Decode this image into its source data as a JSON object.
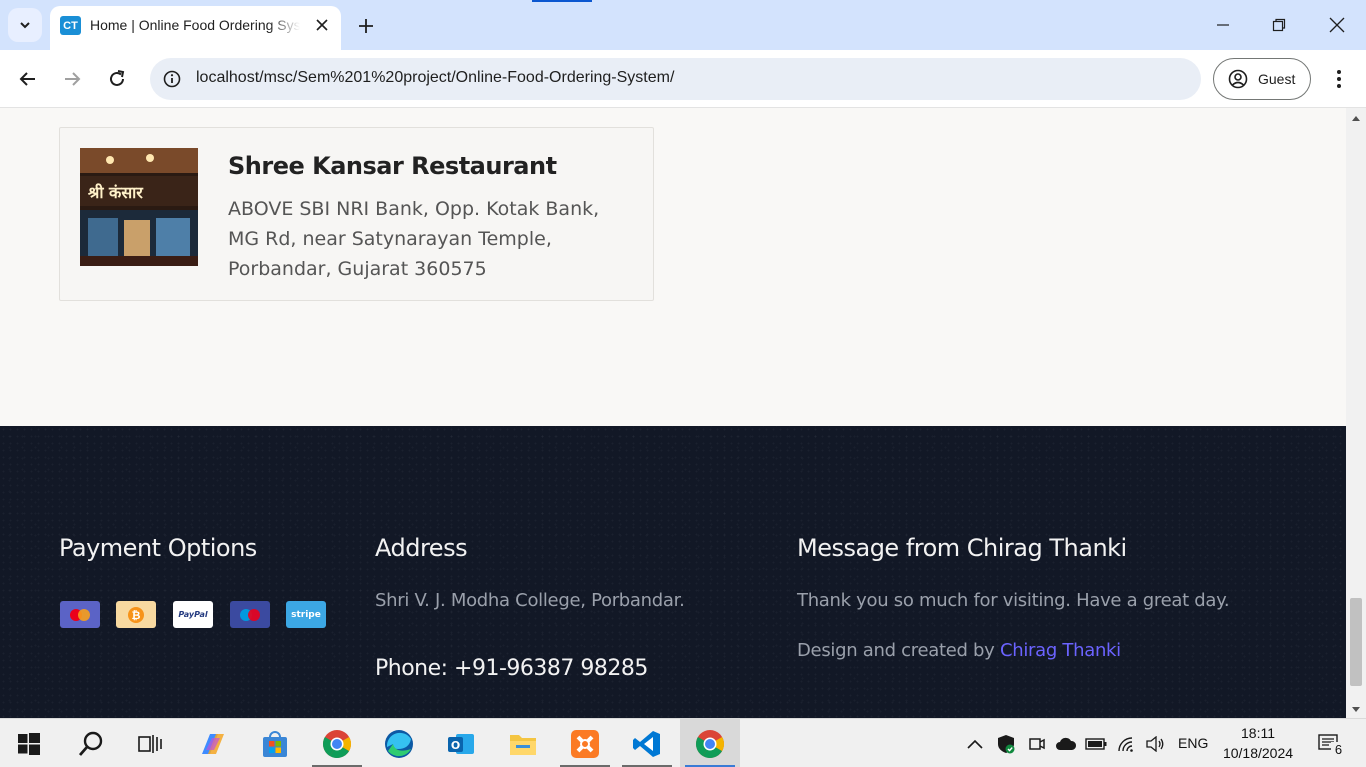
{
  "browser": {
    "tab": {
      "favicon_text": "CT",
      "title": "Home | Online Food Ordering System"
    },
    "url": "localhost/msc/Sem%201%20project/Online-Food-Ordering-System/",
    "profile_label": "Guest"
  },
  "restaurant_card": {
    "name": "Shree Kansar Restaurant",
    "address": "ABOVE SBI NRI Bank, Opp. Kotak Bank, MG Rd, near Satynarayan Temple, Porbandar, Gujarat 360575"
  },
  "footer": {
    "payment": {
      "heading": "Payment Options",
      "methods": [
        {
          "name": "mastercard-icon",
          "bg": "#5b63c6"
        },
        {
          "name": "bitcoin-icon",
          "bg": "#f8d9a0"
        },
        {
          "name": "paypal-icon",
          "bg": "#ffffff",
          "label": "PayPal"
        },
        {
          "name": "maestro-icon",
          "bg": "#3b4aa0"
        },
        {
          "name": "stripe-icon",
          "bg": "#3ca7e4",
          "label": "stripe"
        }
      ]
    },
    "address": {
      "heading": "Address",
      "text": "Shri V. J. Modha College, Porbandar.",
      "phone": "Phone: +91-96387 98285"
    },
    "message": {
      "heading": "Message from Chirag Thanki",
      "text": "Thank you so much for visiting. Have a great day.",
      "credit_prefix": "Design and created by",
      "credit_link": "Chirag Thanki"
    }
  },
  "taskbar": {
    "language": "ENG",
    "time": "18:11",
    "date": "10/18/2024",
    "notification_count": "6"
  },
  "colors": {
    "footer_bg": "#121826",
    "link": "#6b63ff",
    "tab_bar": "#d3e3fd"
  }
}
